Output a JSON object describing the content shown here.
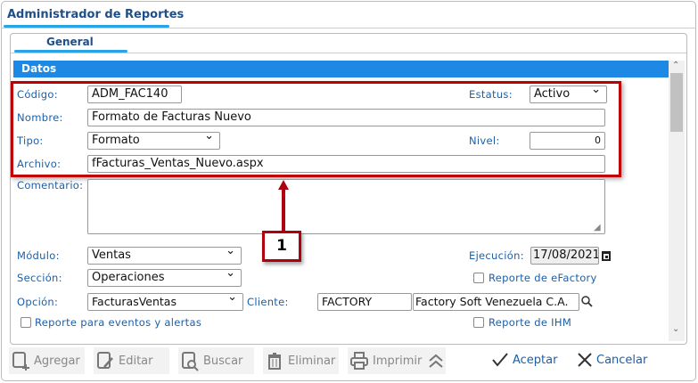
{
  "window": {
    "title": "Administrador de Reportes",
    "tab": "General",
    "section": "Datos"
  },
  "form": {
    "codigo": {
      "label": "Código:",
      "value": "ADM_FAC140"
    },
    "estatus": {
      "label": "Estatus:",
      "value": "Activo"
    },
    "nombre": {
      "label": "Nombre:",
      "value": "Formato de Facturas Nuevo"
    },
    "tipo": {
      "label": "Tipo:",
      "value": "Formato"
    },
    "nivel": {
      "label": "Nivel:",
      "value": "0"
    },
    "archivo": {
      "label": "Archivo:",
      "value": "fFacturas_Ventas_Nuevo.aspx"
    },
    "comentario": {
      "label": "Comentario:",
      "value": ""
    },
    "modulo": {
      "label": "Módulo:",
      "value": "Ventas"
    },
    "ejecucion": {
      "label": "Ejecución:",
      "value": "17/08/2021"
    },
    "seccion": {
      "label": "Sección:",
      "value": "Operaciones"
    },
    "reporte_efactory": {
      "label": "Reporte de eFactory",
      "checked": false
    },
    "opcion": {
      "label": "Opción:",
      "value": "FacturasVentas"
    },
    "cliente": {
      "label": "Cliente:",
      "code": "FACTORY",
      "name": "Factory Soft Venezuela C.A."
    },
    "reporte_eventos": {
      "label": "Reporte para eventos y alertas",
      "checked": false
    },
    "reporte_ihm": {
      "label": "Reporte de IHM",
      "checked": false
    }
  },
  "callout": "1",
  "toolbar": {
    "agregar": "Agregar",
    "editar": "Editar",
    "buscar": "Buscar",
    "eliminar": "Eliminar",
    "imprimir": "Imprimir",
    "aceptar": "Aceptar",
    "cancelar": "Cancelar"
  }
}
